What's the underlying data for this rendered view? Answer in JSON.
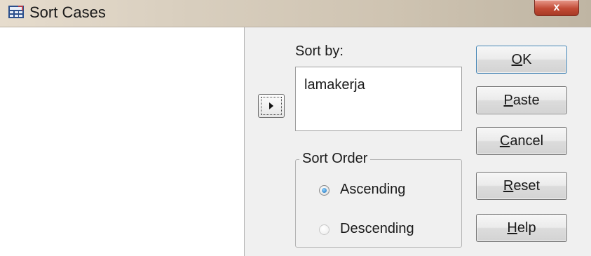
{
  "window": {
    "title": "Sort Cases",
    "close_glyph": "x",
    "app_icon": "spss-data-icon"
  },
  "sort_by": {
    "label": "Sort by:",
    "move_button_icon": "arrow-right-icon",
    "items": [
      "lamakerja"
    ]
  },
  "sort_order": {
    "legend": "Sort Order",
    "ascending_label": "Ascending",
    "descending_label": "Descending",
    "selected": "Ascending"
  },
  "buttons": {
    "ok": {
      "mnemonic": "O",
      "rest": "K"
    },
    "paste": {
      "mnemonic": "P",
      "rest": "aste"
    },
    "cancel": {
      "mnemonic": "C",
      "rest": "ancel"
    },
    "reset": {
      "mnemonic": "R",
      "rest": "eset"
    },
    "help": {
      "mnemonic": "H",
      "rest": "elp"
    }
  },
  "colors": {
    "close_button": "#c24b36",
    "panel_background": "#f0f0f0",
    "default_button_border": "#3c7fb1",
    "radio_selected": "#1c6fb8"
  }
}
